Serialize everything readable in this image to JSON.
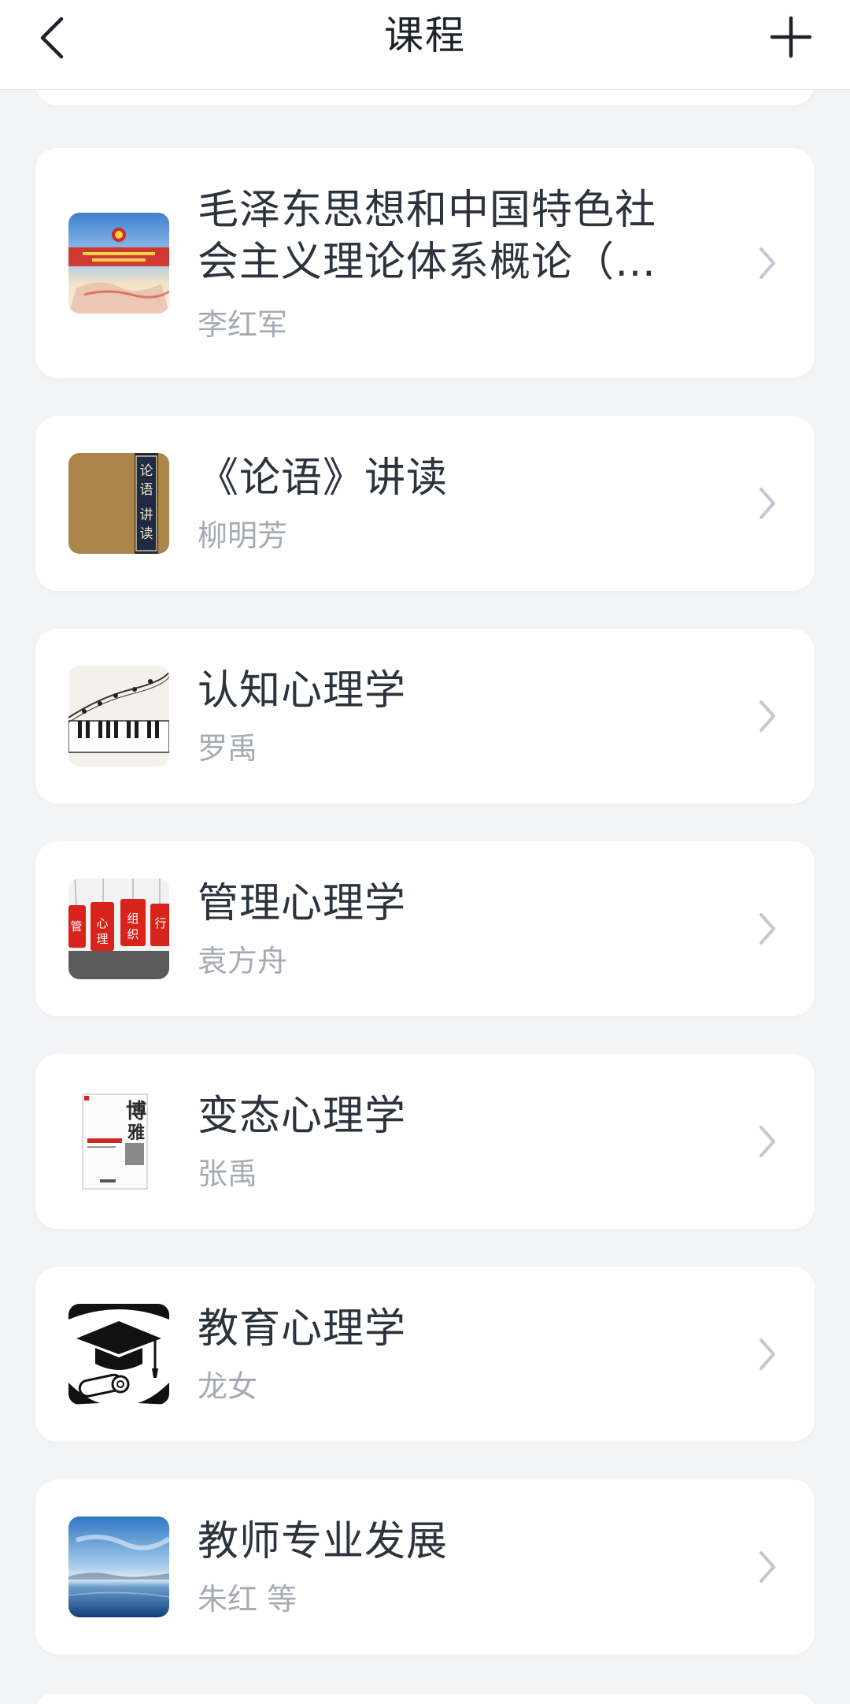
{
  "header": {
    "title": "课程",
    "back_icon": "chevron-left-icon",
    "add_icon": "plus-icon"
  },
  "courses": [
    {
      "title": "毛泽东思想和中国特色社会主义理论体系概论（…",
      "title_line1": "毛泽东思想和中国特色社",
      "title_line2": "会主义理论体系概论（…",
      "teacher": "李红军",
      "thumb": "red-banner-thumbnail"
    },
    {
      "title": "《论语》讲读",
      "teacher": "柳明芳",
      "thumb": "book-cover-thumbnail",
      "thumb_text": "论语讲读"
    },
    {
      "title": "认知心理学",
      "teacher": "罗禹",
      "thumb": "piano-keys-thumbnail"
    },
    {
      "title": "管理心理学",
      "teacher": "袁方舟",
      "thumb": "red-tags-thumbnail",
      "thumb_tags": [
        "管",
        "心理",
        "组织",
        "行"
      ]
    },
    {
      "title": "变态心理学",
      "teacher": "张禹",
      "thumb": "book-cover-thumbnail",
      "thumb_text": "博雅"
    },
    {
      "title": "教育心理学",
      "teacher": "龙女",
      "thumb": "graduation-cap-thumbnail"
    },
    {
      "title": "教师专业发展",
      "teacher": "朱红 等",
      "thumb": "lake-landscape-thumbnail"
    }
  ],
  "colors": {
    "background": "#f3f4f6",
    "card": "#ffffff",
    "title_text": "#2c333c",
    "teacher_text": "#a6abb3",
    "chevron": "#c4c8ce"
  }
}
